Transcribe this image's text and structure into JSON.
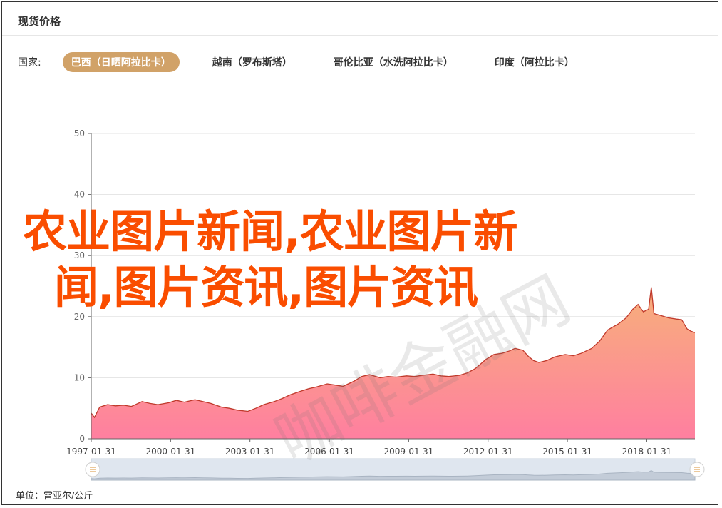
{
  "panel": {
    "title": "现货价格"
  },
  "countries": {
    "label": "国家:",
    "tabs": [
      {
        "label": "巴西（日晒阿拉比卡）",
        "active": true
      },
      {
        "label": "越南（罗布斯塔）",
        "active": false
      },
      {
        "label": "哥伦比亚（水洗阿拉比卡）",
        "active": false
      },
      {
        "label": "印度（阿拉比卡）",
        "active": false
      }
    ]
  },
  "overlay": {
    "line1": "农业图片新闻,农业图片新",
    "line2": "闻,图片资讯,图片资讯"
  },
  "watermark": "咖啡金融网",
  "unit": "单位：雷亚尔/公斤",
  "colors": {
    "accent": "#d1a268",
    "overlay_text": "#fa4d00",
    "line": "#c0392b",
    "area_top": "#f7b07a",
    "area_bottom": "#ff7fa0"
  },
  "chart_data": {
    "type": "area",
    "x_ticks": [
      "1997-01-31",
      "2000-01-31",
      "2003-01-31",
      "2006-01-31",
      "2009-01-31",
      "2012-01-31",
      "2015-01-31",
      "2018-01-31"
    ],
    "y_ticks": [
      0,
      10,
      20,
      30,
      40,
      50
    ],
    "ylim": [
      0,
      50
    ],
    "xlim": [
      1997.08,
      2019.9
    ],
    "grid": true,
    "series": [
      {
        "points": [
          [
            1997.08,
            4.2
          ],
          [
            1997.2,
            3.5
          ],
          [
            1997.4,
            5.2
          ],
          [
            1997.7,
            5.6
          ],
          [
            1998.0,
            5.4
          ],
          [
            1998.3,
            5.5
          ],
          [
            1998.6,
            5.3
          ],
          [
            1999.0,
            6.1
          ],
          [
            1999.3,
            5.8
          ],
          [
            1999.6,
            5.6
          ],
          [
            2000.0,
            5.9
          ],
          [
            2000.3,
            6.3
          ],
          [
            2000.6,
            6.0
          ],
          [
            2001.0,
            6.4
          ],
          [
            2001.3,
            6.1
          ],
          [
            2001.6,
            5.8
          ],
          [
            2002.0,
            5.2
          ],
          [
            2002.3,
            5.0
          ],
          [
            2002.6,
            4.7
          ],
          [
            2003.0,
            4.5
          ],
          [
            2003.3,
            5.0
          ],
          [
            2003.6,
            5.6
          ],
          [
            2004.0,
            6.1
          ],
          [
            2004.3,
            6.6
          ],
          [
            2004.6,
            7.2
          ],
          [
            2005.0,
            7.8
          ],
          [
            2005.3,
            8.2
          ],
          [
            2005.6,
            8.5
          ],
          [
            2006.0,
            9.0
          ],
          [
            2006.3,
            8.8
          ],
          [
            2006.6,
            8.6
          ],
          [
            2007.0,
            9.4
          ],
          [
            2007.3,
            10.2
          ],
          [
            2007.6,
            10.5
          ],
          [
            2008.0,
            10.0
          ],
          [
            2008.3,
            10.2
          ],
          [
            2008.6,
            10.1
          ],
          [
            2009.0,
            10.3
          ],
          [
            2009.3,
            10.2
          ],
          [
            2009.6,
            10.4
          ],
          [
            2010.0,
            10.6
          ],
          [
            2010.3,
            10.3
          ],
          [
            2010.6,
            10.2
          ],
          [
            2011.0,
            10.4
          ],
          [
            2011.3,
            10.8
          ],
          [
            2011.6,
            11.5
          ],
          [
            2012.0,
            13.0
          ],
          [
            2012.3,
            13.8
          ],
          [
            2012.6,
            14.0
          ],
          [
            2012.9,
            14.4
          ],
          [
            2013.1,
            14.8
          ],
          [
            2013.4,
            14.5
          ],
          [
            2013.6,
            13.5
          ],
          [
            2013.8,
            12.8
          ],
          [
            2014.0,
            12.5
          ],
          [
            2014.3,
            12.8
          ],
          [
            2014.6,
            13.4
          ],
          [
            2015.0,
            13.8
          ],
          [
            2015.3,
            13.6
          ],
          [
            2015.6,
            14.0
          ],
          [
            2016.0,
            14.8
          ],
          [
            2016.3,
            16.0
          ],
          [
            2016.6,
            17.8
          ],
          [
            2017.0,
            18.8
          ],
          [
            2017.3,
            19.8
          ],
          [
            2017.55,
            21.2
          ],
          [
            2017.75,
            22.0
          ],
          [
            2017.95,
            20.8
          ],
          [
            2018.15,
            21.2
          ],
          [
            2018.25,
            24.8
          ],
          [
            2018.35,
            20.5
          ],
          [
            2018.6,
            20.2
          ],
          [
            2018.9,
            19.8
          ],
          [
            2019.2,
            19.6
          ],
          [
            2019.4,
            19.5
          ],
          [
            2019.6,
            18.0
          ],
          [
            2019.75,
            17.6
          ],
          [
            2019.9,
            17.4
          ]
        ]
      }
    ]
  }
}
